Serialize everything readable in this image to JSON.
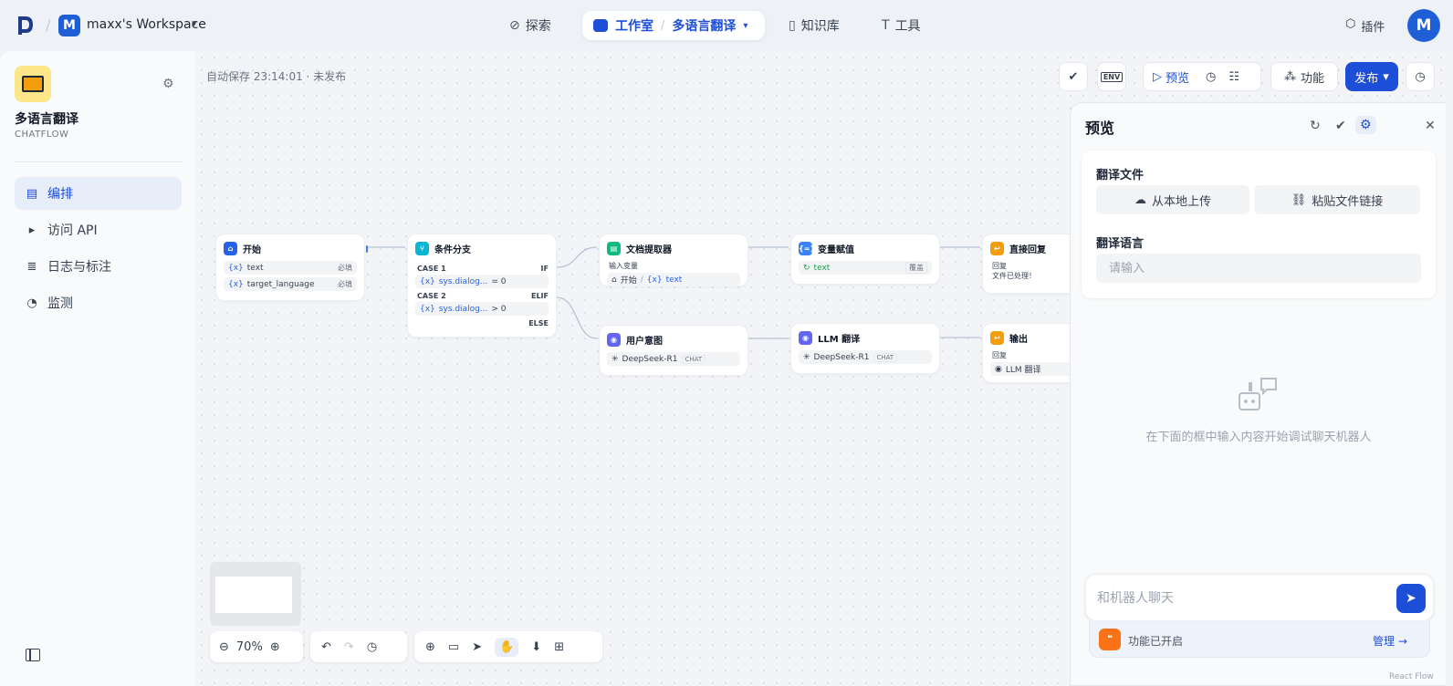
{
  "workspace": {
    "initial": "M",
    "name": "maxx's Workspace"
  },
  "nav": {
    "explore": "探索",
    "studio": "工作室",
    "app": "多语言翻译",
    "knowledge": "知识库",
    "tools": "工具",
    "plugins": "插件"
  },
  "user": {
    "initial": "M"
  },
  "sidebar": {
    "app_title": "多语言翻译",
    "app_type": "CHATFLOW",
    "items": [
      {
        "label": "编排",
        "icon": "layout-icon",
        "active": true
      },
      {
        "label": "访问 API",
        "icon": "terminal-icon"
      },
      {
        "label": "日志与标注",
        "icon": "log-icon"
      },
      {
        "label": "监测",
        "icon": "gauge-icon"
      }
    ]
  },
  "toolbar": {
    "autosave": "自动保存 23:14:01 · 未发布",
    "env": "ENV",
    "preview": "预览",
    "features": "功能",
    "publish": "发布"
  },
  "nodes": {
    "start": {
      "title": "开始",
      "vars": [
        "text",
        "target_language"
      ],
      "required": "必填"
    },
    "ifelse": {
      "title": "条件分支",
      "case1": "CASE 1",
      "if": "IF",
      "cond1_var": "sys.dialog...",
      "cond1_op": "= 0",
      "case2": "CASE 2",
      "elif": "ELIF",
      "cond2_var": "sys.dialog...",
      "cond2_op": "> 0",
      "else": "ELSE"
    },
    "doc": {
      "title": "文档提取器",
      "sub": "输入变量",
      "src": "开始",
      "var": "text"
    },
    "assign": {
      "title": "变量赋值",
      "var": "text",
      "op": "覆盖"
    },
    "answer1": {
      "title": "直接回复",
      "sub": "回复",
      "text": "文件已处理！"
    },
    "intent": {
      "title": "用户意图",
      "model": "DeepSeek-R1",
      "mode": "CHAT"
    },
    "llm": {
      "title": "LLM 翻译",
      "model": "DeepSeek-R1",
      "mode": "CHAT"
    },
    "answer2": {
      "title": "输出",
      "sub": "回复",
      "src": "LLM 翻译"
    }
  },
  "zoom": {
    "level": "70%"
  },
  "preview_panel": {
    "title": "预览",
    "file_label": "翻译文件",
    "upload_local": "从本地上传",
    "paste_link": "粘贴文件链接",
    "lang_label": "翻译语言",
    "lang_placeholder": "请输入",
    "empty_hint": "在下面的框中输入内容开始调试聊天机器人",
    "chat_placeholder": "和机器人聊天",
    "features_on": "功能已开启",
    "manage": "管理 →"
  },
  "footer": {
    "reactflow": "React Flow"
  },
  "colors": {
    "primary": "#1d4ed8",
    "start": "#2563eb",
    "ifelse": "#06b6d4",
    "doc": "#10b981",
    "assign": "#3b82f6",
    "answer": "#f59e0b",
    "intent": "#6366f1"
  }
}
